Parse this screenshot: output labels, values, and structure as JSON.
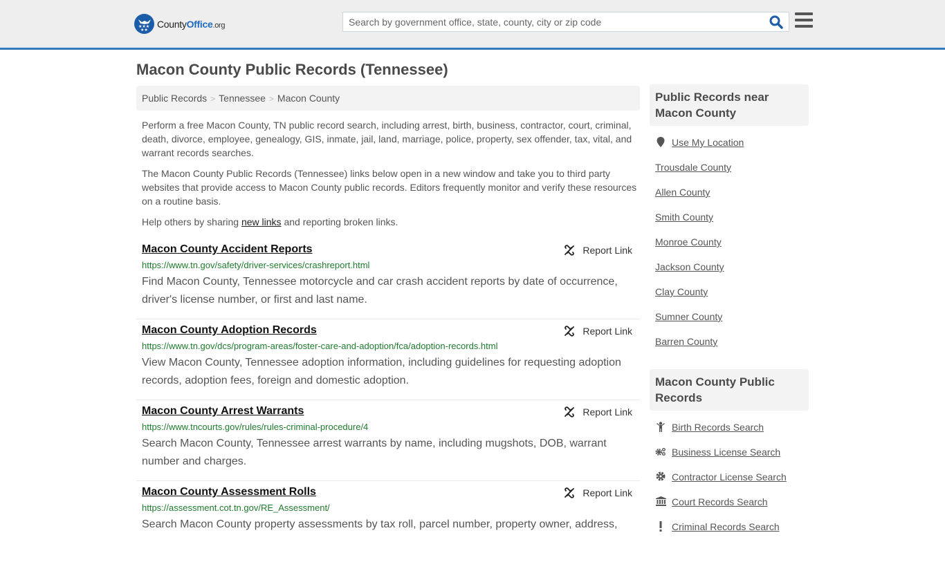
{
  "header": {
    "logo": {
      "county": "County",
      "office": "Office",
      "org": ".org"
    },
    "search": {
      "placeholder": "Search by government office, state, county, city or zip code",
      "value": ""
    },
    "colors": {
      "accent": "#337ab7",
      "brand": "#1b5ca8",
      "url_green": "#1f7a2e"
    }
  },
  "page": {
    "title": "Macon County Public Records (Tennessee)",
    "breadcrumb": [
      "Public Records",
      "Tennessee",
      "Macon County"
    ],
    "breadcrumb_separator": ">",
    "intro": {
      "p1": "Perform a free Macon County, TN public record search, including arrest, birth, business, contractor, court, criminal, death, divorce, employee, genealogy, GIS, inmate, jail, land, marriage, police, property, sex offender, tax, vital, and warrant records searches.",
      "p2": "The Macon County Public Records (Tennessee) links below open in a new window and take you to third party websites that provide access to Macon County public records. Editors frequently monitor and verify these resources on a routine basis.",
      "p3_before": "Help others by sharing ",
      "p3_link": "new links",
      "p3_after": " and reporting broken links."
    },
    "report_label": "Report Link",
    "records": [
      {
        "title": "Macon County Accident Reports",
        "url": "https://www.tn.gov/safety/driver-services/crashreport.html",
        "description": "Find Macon County, Tennessee motorcycle and car crash accident reports by date of occurrence, driver's license number, or first and last name."
      },
      {
        "title": "Macon County Adoption Records",
        "url": "https://www.tn.gov/dcs/program-areas/foster-care-and-adoption/fca/adoption-records.html",
        "description": "View Macon County, Tennessee adoption information, including guidelines for requesting adoption records, adoption fees, foreign and domestic adoption."
      },
      {
        "title": "Macon County Arrest Warrants",
        "url": "https://www.tncourts.gov/rules/rules-criminal-procedure/4",
        "description": "Search Macon County, Tennessee arrest warrants by name, including mugshots, DOB, warrant number and charges."
      },
      {
        "title": "Macon County Assessment Rolls",
        "url": "https://assessment.cot.tn.gov/RE_Assessment/",
        "description": "Search Macon County property assessments by tax roll, parcel number, property owner, address,"
      }
    ]
  },
  "sidebar": {
    "nearby": {
      "heading": "Public Records near Macon County",
      "use_location": {
        "label": "Use My Location",
        "icon": "map-marker-icon"
      },
      "counties": [
        "Trousdale County",
        "Allen County",
        "Smith County",
        "Monroe County",
        "Jackson County",
        "Clay County",
        "Sumner County",
        "Barren County"
      ]
    },
    "county_records": {
      "heading": "Macon County Public Records",
      "items": [
        {
          "label": "Birth Records Search",
          "icon": "child-icon"
        },
        {
          "label": "Business License Search",
          "icon": "gears-icon"
        },
        {
          "label": "Contractor License Search",
          "icon": "gear-icon"
        },
        {
          "label": "Court Records Search",
          "icon": "courthouse-icon"
        },
        {
          "label": "Criminal Records Search",
          "icon": "exclamation-icon"
        }
      ]
    }
  }
}
